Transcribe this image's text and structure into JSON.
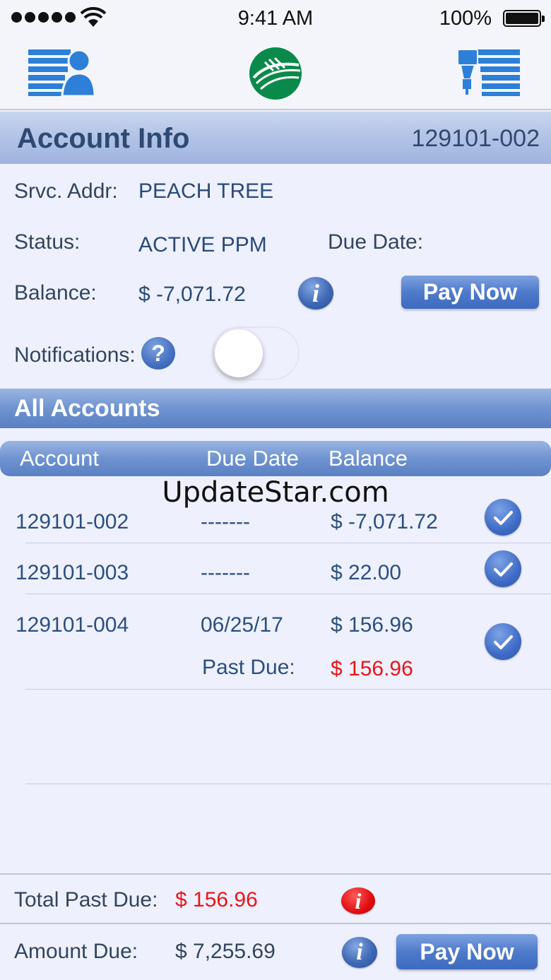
{
  "status_bar": {
    "time": "9:41 AM",
    "battery": "100%"
  },
  "nav": {
    "left_icon": "account-list-icon",
    "center_logo": "coop-logo",
    "right_icon": "outage-list-icon"
  },
  "account_info": {
    "title": "Account Info",
    "account_number": "129101-002",
    "srvc_addr_label": "Srvc. Addr:",
    "srvc_addr": "PEACH TREE",
    "status_label": "Status:",
    "status": "ACTIVE PPM",
    "due_date_label": "Due Date:",
    "balance_label": "Balance:",
    "balance": "$ -7,071.72",
    "pay_now": "Pay Now",
    "notifications_label": "Notifications:",
    "help": "?",
    "info": "i"
  },
  "all_accounts": {
    "title": "All Accounts",
    "columns": [
      "Account",
      "Due Date",
      "Balance"
    ],
    "rows": [
      {
        "account": "129101-002",
        "due_date": "-------",
        "balance": "$ -7,071.72"
      },
      {
        "account": "129101-003",
        "due_date": "-------",
        "balance": "$ 22.00"
      },
      {
        "account": "129101-004",
        "due_date": "06/25/17",
        "balance": "$ 156.96",
        "past_due_label": "Past Due:",
        "past_due": "$ 156.96"
      }
    ]
  },
  "watermark": "UpdateStar.com",
  "footer": {
    "total_past_due_label": "Total Past Due:",
    "total_past_due": "$ 156.96",
    "amount_due_label": "Amount Due:",
    "amount_due": "$ 7,255.69",
    "pay_now": "Pay Now",
    "info": "i"
  },
  "colors": {
    "accent_blue": "#4f7bcb",
    "alert_red": "#e8161b",
    "logo_green": "#0a8a4a"
  }
}
